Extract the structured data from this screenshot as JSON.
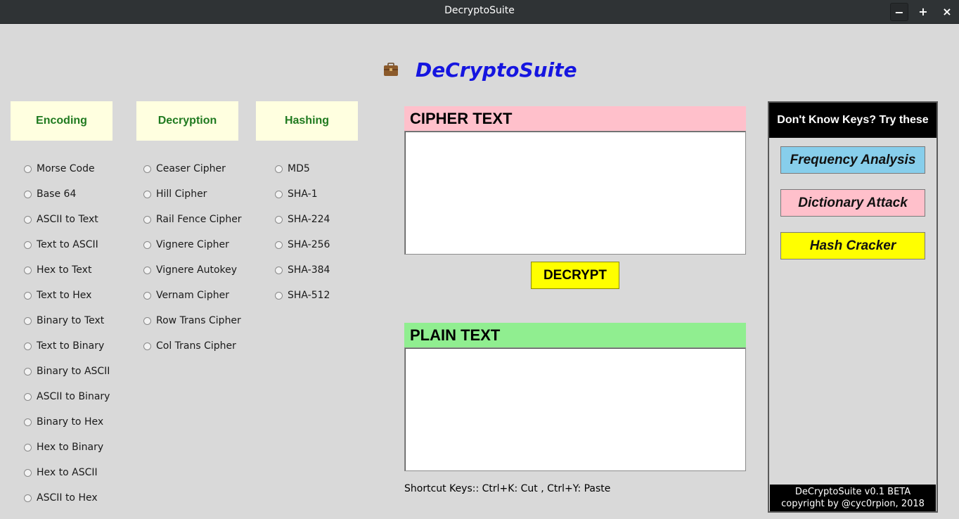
{
  "window": {
    "title": "DecryptoSuite",
    "minimize": "−",
    "maximize": "+",
    "close": "×"
  },
  "app": {
    "icon": "briefcase-icon",
    "title": "DeCryptoSuite"
  },
  "categories": {
    "encoding": "Encoding",
    "decryption": "Decryption",
    "hashing": "Hashing"
  },
  "encoding_options": [
    "Morse Code",
    "Base 64",
    "ASCII to Text",
    "Text to ASCII",
    "Hex to Text",
    "Text to Hex",
    "Binary to Text",
    "Text to Binary",
    "Binary to ASCII",
    "ASCII to Binary",
    "Binary to Hex",
    "Hex to Binary",
    "Hex to ASCII",
    "ASCII to Hex"
  ],
  "decryption_options": [
    "Ceaser Cipher",
    "Hill Cipher",
    "Rail Fence Cipher",
    "Vignere Cipher",
    "Vignere Autokey",
    "Vernam Cipher",
    "Row Trans Cipher",
    "Col Trans Cipher"
  ],
  "hashing_options": [
    "MD5",
    "SHA-1",
    "SHA-224",
    "SHA-256",
    "SHA-384",
    "SHA-512"
  ],
  "cipher": {
    "label": "CIPHER TEXT",
    "value": "",
    "header_color": "#ffc0cb"
  },
  "decrypt_button": "DECRYPT",
  "plain": {
    "label": "PLAIN TEXT",
    "value": "",
    "header_color": "#90ee90"
  },
  "shortcuts": "Shortcut Keys:: Ctrl+K: Cut , Ctrl+Y: Paste",
  "side_panel": {
    "header": "Don't Know Keys? Try these",
    "buttons": [
      {
        "label": "Frequency Analysis",
        "color": "#87ceeb"
      },
      {
        "label": "Dictionary Attack",
        "color": "#ffc0cb"
      },
      {
        "label": "Hash Cracker",
        "color": "#ffff00"
      }
    ],
    "footer_line1": "DeCryptoSuite v0.1 BETA",
    "footer_line2": "copyright by @cyc0rpion, 2018"
  },
  "colors": {
    "title_blue": "#1515e0",
    "category_bg": "#ffffe0",
    "category_text": "#1f7a1f",
    "decrypt_bg": "#ffff00"
  }
}
